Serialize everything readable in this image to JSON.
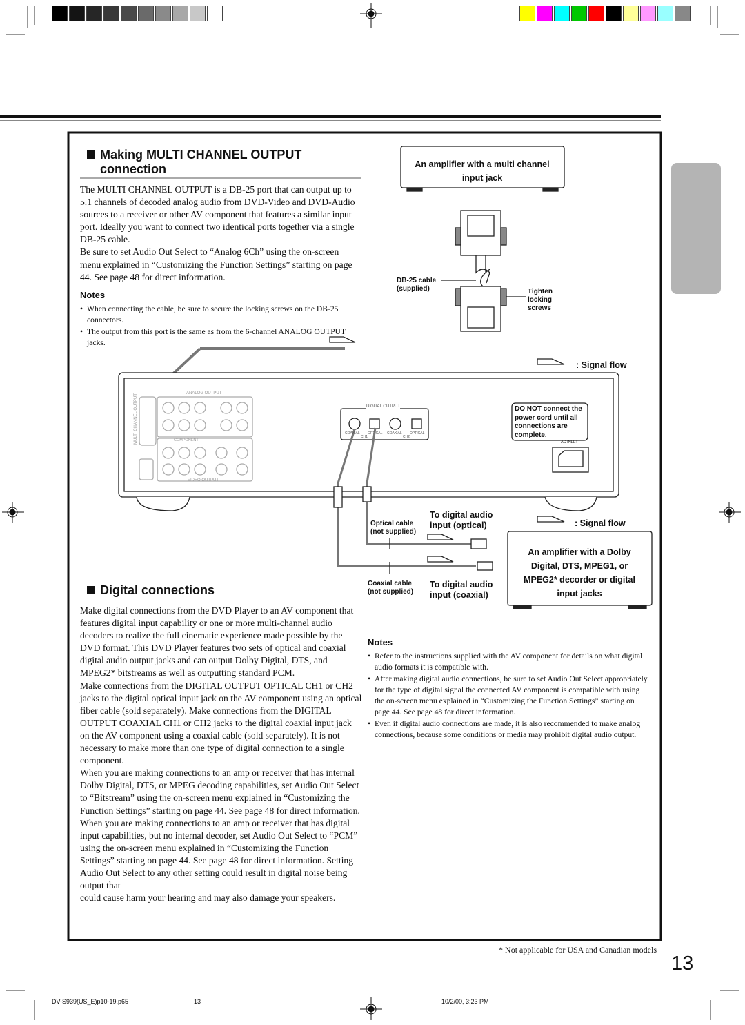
{
  "colors": {
    "grayscale": [
      "#000000",
      "#141414",
      "#262626",
      "#383838",
      "#4a4a4a",
      "#6a6a6a",
      "#8a8a8a",
      "#a8a8a8",
      "#c8c8c8",
      "#ffffff"
    ],
    "color_bar": [
      "#ffff00",
      "#ff00ff",
      "#00ffff",
      "#00c800",
      "#ff0000",
      "#000000",
      "#ffff99",
      "#ff99ff",
      "#99ffff",
      "#888888"
    ],
    "side_tab": "#b4b4b4"
  },
  "multi": {
    "heading": "Making MULTI CHANNEL OUTPUT connection",
    "paragraphs": [
      "The MULTI CHANNEL OUTPUT is a DB-25 port that can output up to 5.1 channels of decoded analog audio from DVD-Video and DVD-Audio sources to a receiver or other AV component that features a similar input port. Ideally you want to connect two identical ports together via a single DB-25 cable.",
      "Be sure to set Audio Out Select to “Analog 6Ch” using the on-screen menu explained in “Customizing the Function Settings” starting on page 44. See page 48 for direct information."
    ],
    "notes_title": "Notes",
    "notes": [
      "When connecting the cable, be sure to secure the locking screws on the DB-25 connectors.",
      "The output from this port is the same as from the 6-channel ANALOG OUTPUT jacks."
    ]
  },
  "diagram": {
    "amp_multi": "An amplifier with a multi channel input jack",
    "db25_cable": "DB-25 cable (supplied)",
    "tighten": "Tighten locking screws",
    "signal_flow": ": Signal flow",
    "analog_output": "ANALOG OUTPUT",
    "video_output": "VIDEO OUTPUT",
    "component": "COMPONENT",
    "multi_channel_output": "MULTI CHANNEL OUTPUT",
    "digital_output": "DIGITAL OUTPUT",
    "jacks": [
      "COAXIAL",
      "OPTICAL",
      "COAXIAL",
      "OPTICAL"
    ],
    "ch1": "CH1",
    "ch2": "CH2",
    "warning": "DO NOT connect the power cord until all connections are complete.",
    "ac_inlet": "AC INLET",
    "optical_cable": "Optical cable (not supplied)",
    "coaxial_cable": "Coaxial cable (not supplied)",
    "to_optical": "To digital audio input (optical)",
    "to_coaxial": "To digital audio input (coaxial)",
    "amp_dolby": "An amplifier with a Dolby Digital, DTS, MPEG1, or MPEG2* decorder or digital input jacks"
  },
  "digital": {
    "heading": "Digital connections",
    "paragraphs": [
      "Make digital connections from the DVD Player to an AV component that features digital input capability or one or more multi-channel audio decoders to realize the full cinematic experience made possible by the DVD format. This DVD Player features two sets of optical and coaxial digital audio output jacks and can output Dolby Digital, DTS, and MPEG2* bitstreams as well as outputting standard PCM.",
      "Make connections from the DIGITAL OUTPUT OPTICAL CH1 or CH2 jacks to the digital optical input jack on the AV component using an optical fiber cable (sold separately). Make connections from the DIGITAL OUTPUT COAXIAL CH1 or CH2 jacks to the digital coaxial input jack on the AV component using a coaxial cable (sold separately). It is not necessary to make more than one type of digital connection to a single component.",
      "When you are making connections to an amp or receiver that has internal Dolby Digital, DTS, or MPEG decoding capabilities, set Audio Out Select to “Bitstream” using the on-screen menu explained in “Customizing the Function Settings” starting on page 44. See page 48 for direct information.",
      "When you are making connections to an amp or receiver that has digital input capabilities, but no internal decoder, set Audio Out Select to “PCM” using the on-screen menu explained in “Customizing the Function Settings” starting on page 44. See page 48 for direct information. Setting Audio Out Select to any other setting could result in digital noise being output that",
      "could cause harm your hearing and may also damage your speakers."
    ],
    "notes_title": "Notes",
    "notes": [
      "Refer to the instructions supplied with the AV component for details on what digital audio formats it is compatible with.",
      "After making digital audio connections, be sure to set Audio Out Select appropriately for the type of digital signal the connected AV component is compatible with using the on-screen menu explained in “Customizing the Function Settings” starting on page 44. See page 48 for direct information.",
      "Even if digital audio connections are made, it is also recommended to make analog connections, because some conditions or media may prohibit digital audio output."
    ]
  },
  "footnote": "* Not applicable for USA and Canadian models",
  "page_number": "13",
  "footer": {
    "file": "DV-S939(US_E)p10-19.p65",
    "page": "13",
    "date": "10/2/00, 3:23 PM"
  }
}
